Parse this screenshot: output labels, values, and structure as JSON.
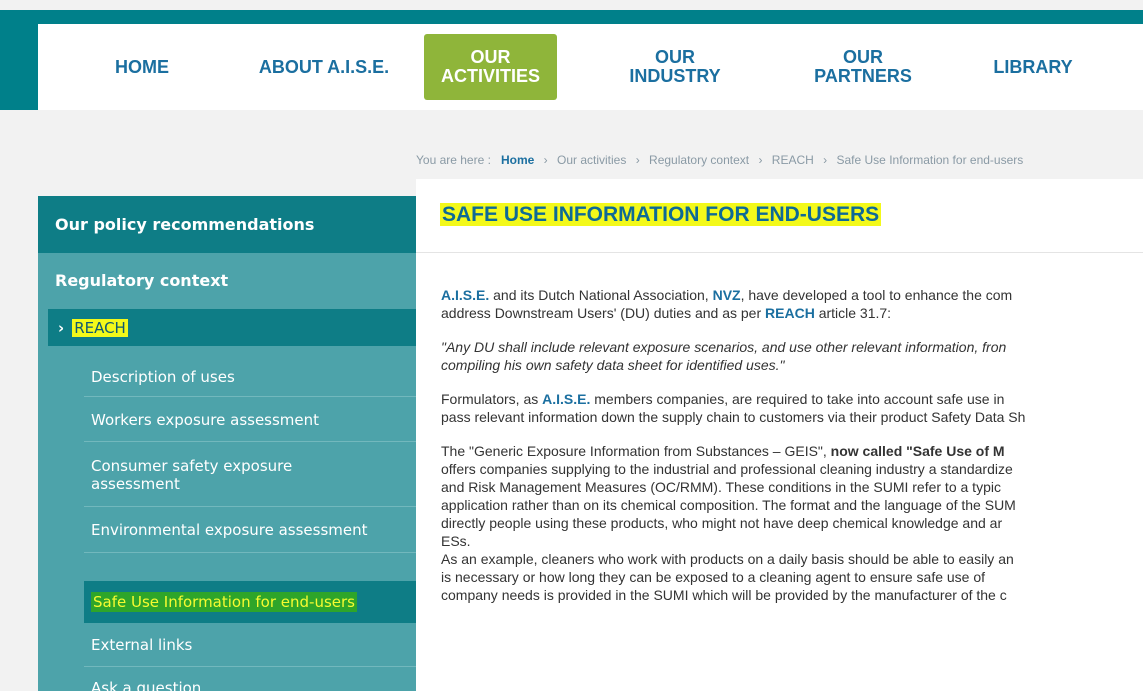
{
  "nav": {
    "items": [
      {
        "line1": "HOME",
        "line2": ""
      },
      {
        "line1": "ABOUT A.I.S.E.",
        "line2": ""
      },
      {
        "line1": "OUR",
        "line2": "ACTIVITIES"
      },
      {
        "line1": "OUR",
        "line2": "INDUSTRY"
      },
      {
        "line1": "OUR",
        "line2": "PARTNERS"
      },
      {
        "line1": "LIBRARY",
        "line2": ""
      }
    ]
  },
  "breadcrumb": {
    "prefix": "You are here :",
    "items": [
      "Home",
      "Our activities",
      "Regulatory context",
      "REACH",
      "Safe Use Information for end-users"
    ],
    "sep": "›"
  },
  "sidebar": {
    "policy": "Our policy recommendations",
    "regulatory": "Regulatory context",
    "reach_chev": "›",
    "reach": "REACH",
    "subitems": [
      "Description of uses",
      "Workers exposure assessment",
      "Consumer safety exposure assessment",
      "Environmental exposure assessment",
      "Safe Use Information for end-users",
      "External links",
      "Ask a question"
    ]
  },
  "content": {
    "title": "SAFE USE INFORMATION FOR END-USERS",
    "p1": {
      "a1": "A.I.S.E.",
      "t1": " and its Dutch National Association, ",
      "a2": "NVZ",
      "t2": ", have developed a tool to enhance the com",
      "t3": "address Downstream Users' (DU) duties and as per ",
      "a3": "REACH",
      "t4": " article 31.7:"
    },
    "quote": {
      "l1": "\"Any DU shall include relevant exposure scenarios, and use other relevant information, fron",
      "l2": "compiling his own safety data sheet for identified uses.\""
    },
    "p3": {
      "t1": "Formulators, as ",
      "a1": "A.I.S.E.",
      "t2": " members companies, are required to take into account safe use in",
      "l2": "pass relevant information down the supply chain to customers via their product Safety Data Sh"
    },
    "p4": {
      "t1": "The \"Generic Exposure Information from Substances – GEIS\", ",
      "b1": "now called \"Safe Use of M",
      "l2": "offers companies supplying to the industrial and professional cleaning industry a standardize",
      "l3": "and Risk Management Measures (OC/RMM). These conditions in the SUMI refer to a typic",
      "l4": "application rather than on its chemical composition. The format and the language of the SUM",
      "l5": "directly people using these products, who might not have deep chemical knowledge and ar",
      "l6": "ESs."
    },
    "p5": {
      "l1": "As an example, cleaners who work with products on a daily basis should be able to easily an",
      "l2": "is necessary or how long they can be exposed to a cleaning agent to ensure safe use of",
      "l3": "company needs is provided in the SUMI which will be provided by the manufacturer of the c"
    }
  },
  "colors": {
    "teal": "#00808a",
    "sidebar": "#4da3aa",
    "sidebar_dark": "#0e7d86",
    "active_nav": "#8fb53a",
    "link": "#1b6fa0",
    "highlight": "#f3f91a"
  }
}
